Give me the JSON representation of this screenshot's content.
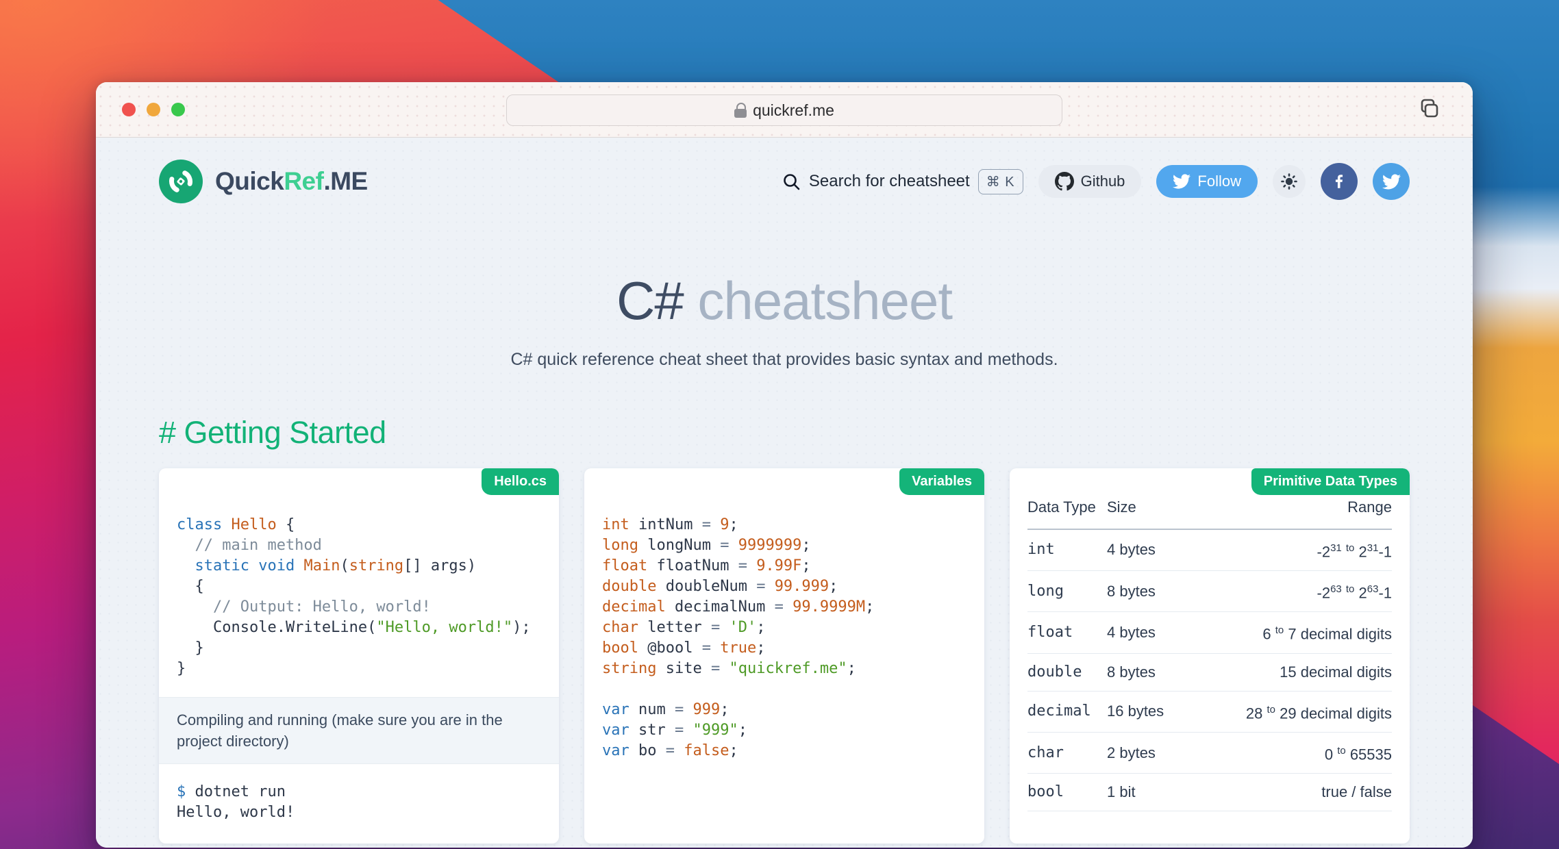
{
  "browser": {
    "url": "quickref.me"
  },
  "nav": {
    "brand": {
      "part1": "Quick",
      "part2": "Ref",
      "part3": ".ME"
    },
    "search_label": "Search for cheatsheet",
    "search_shortcut": "⌘ K",
    "github_label": "Github",
    "follow_label": "Follow"
  },
  "hero": {
    "title_primary": "C#",
    "title_secondary": " cheatsheet",
    "subtitle": "C# quick reference cheat sheet that provides basic syntax and methods."
  },
  "section_heading": "# Getting Started",
  "cards": [
    {
      "badge": "Hello.cs",
      "blocks": [
        {
          "kind": "code",
          "lines": [
            [
              [
                "kw",
                "class"
              ],
              [
                "pl",
                " "
              ],
              [
                "tn",
                "Hello"
              ],
              [
                "pl",
                " {"
              ]
            ],
            [
              [
                "cm",
                "  // main method"
              ]
            ],
            [
              [
                "pl",
                "  "
              ],
              [
                "kw",
                "static"
              ],
              [
                "pl",
                " "
              ],
              [
                "kw",
                "void"
              ],
              [
                "pl",
                " "
              ],
              [
                "tn",
                "Main"
              ],
              [
                "pl",
                "("
              ],
              [
                "tn",
                "string"
              ],
              [
                "pl",
                "[] args)"
              ]
            ],
            [
              [
                "pl",
                "  {"
              ]
            ],
            [
              [
                "cm",
                "    // Output: Hello, world!"
              ]
            ],
            [
              [
                "pl",
                "    Console.WriteLine("
              ],
              [
                "st",
                "\"Hello, world!\""
              ],
              [
                "pl",
                ");"
              ]
            ],
            [
              [
                "pl",
                "  }"
              ]
            ],
            [
              [
                "pl",
                "}"
              ]
            ]
          ]
        },
        {
          "kind": "note",
          "text": "Compiling and running (make sure you are in the project directory)"
        },
        {
          "kind": "code",
          "lines": [
            [
              [
                "kw",
                "$"
              ],
              [
                "pl",
                " dotnet run"
              ]
            ],
            [
              [
                "pl",
                "Hello, world!"
              ]
            ]
          ]
        }
      ]
    },
    {
      "badge": "Variables",
      "blocks": [
        {
          "kind": "code",
          "lines": [
            [
              [
                "tn",
                "int"
              ],
              [
                "pl",
                " intNum "
              ],
              [
                "op",
                "="
              ],
              [
                "pl",
                " "
              ],
              [
                "tn",
                "9"
              ],
              [
                "pl",
                ";"
              ]
            ],
            [
              [
                "tn",
                "long"
              ],
              [
                "pl",
                " longNum "
              ],
              [
                "op",
                "="
              ],
              [
                "pl",
                " "
              ],
              [
                "tn",
                "9999999"
              ],
              [
                "pl",
                ";"
              ]
            ],
            [
              [
                "tn",
                "float"
              ],
              [
                "pl",
                " floatNum "
              ],
              [
                "op",
                "="
              ],
              [
                "pl",
                " "
              ],
              [
                "tn",
                "9.99F"
              ],
              [
                "pl",
                ";"
              ]
            ],
            [
              [
                "tn",
                "double"
              ],
              [
                "pl",
                " doubleNum "
              ],
              [
                "op",
                "="
              ],
              [
                "pl",
                " "
              ],
              [
                "tn",
                "99.999"
              ],
              [
                "pl",
                ";"
              ]
            ],
            [
              [
                "tn",
                "decimal"
              ],
              [
                "pl",
                " decimalNum "
              ],
              [
                "op",
                "="
              ],
              [
                "pl",
                " "
              ],
              [
                "tn",
                "99.9999M"
              ],
              [
                "pl",
                ";"
              ]
            ],
            [
              [
                "tn",
                "char"
              ],
              [
                "pl",
                " letter "
              ],
              [
                "op",
                "="
              ],
              [
                "pl",
                " "
              ],
              [
                "st",
                "'D'"
              ],
              [
                "pl",
                ";"
              ]
            ],
            [
              [
                "tn",
                "bool"
              ],
              [
                "pl",
                " @bool "
              ],
              [
                "op",
                "="
              ],
              [
                "pl",
                " "
              ],
              [
                "tn",
                "true"
              ],
              [
                "pl",
                ";"
              ]
            ],
            [
              [
                "tn",
                "string"
              ],
              [
                "pl",
                " site "
              ],
              [
                "op",
                "="
              ],
              [
                "pl",
                " "
              ],
              [
                "st",
                "\"quickref.me\""
              ],
              [
                "pl",
                ";"
              ]
            ],
            [],
            [
              [
                "kw",
                "var"
              ],
              [
                "pl",
                " num "
              ],
              [
                "op",
                "="
              ],
              [
                "pl",
                " "
              ],
              [
                "tn",
                "999"
              ],
              [
                "pl",
                ";"
              ]
            ],
            [
              [
                "kw",
                "var"
              ],
              [
                "pl",
                " str "
              ],
              [
                "op",
                "="
              ],
              [
                "pl",
                " "
              ],
              [
                "st",
                "\"999\""
              ],
              [
                "pl",
                ";"
              ]
            ],
            [
              [
                "kw",
                "var"
              ],
              [
                "pl",
                " bo "
              ],
              [
                "op",
                "="
              ],
              [
                "pl",
                " "
              ],
              [
                "tn",
                "false"
              ],
              [
                "pl",
                ";"
              ]
            ]
          ]
        }
      ]
    },
    {
      "badge": "Primitive Data Types",
      "table": {
        "headers": [
          "Data Type",
          "Size",
          "Range"
        ],
        "rows": [
          {
            "type": "int",
            "size": "4 bytes",
            "range": "-2^{31} ^{to} 2^{31}-1"
          },
          {
            "type": "long",
            "size": "8 bytes",
            "range": "-2^{63} ^{to} 2^{63}-1"
          },
          {
            "type": "float",
            "size": "4 bytes",
            "range": "6 ^{to} 7 decimal digits"
          },
          {
            "type": "double",
            "size": "8 bytes",
            "range": "15 decimal digits"
          },
          {
            "type": "decimal",
            "size": "16 bytes",
            "range": "28 ^{to} 29 decimal digits"
          },
          {
            "type": "char",
            "size": "2 bytes",
            "range": "0 ^{to} 65535"
          },
          {
            "type": "bool",
            "size": "1 bit",
            "range": "true / false"
          },
          {
            "type": "",
            "size": "",
            "range": ""
          }
        ]
      }
    }
  ],
  "colors": {
    "accent_green": "#14b479",
    "logo_green": "#17a673",
    "follow_blue": "#52a7ee",
    "facebook_blue": "#44619d",
    "twitter_blue": "#4ea2e6",
    "keyword_blue": "#2973b7",
    "type_orange": "#c45d1d",
    "string_green": "#4e9a26",
    "comment_gray": "#7d8b99",
    "page_bg": "#eef2f7"
  }
}
